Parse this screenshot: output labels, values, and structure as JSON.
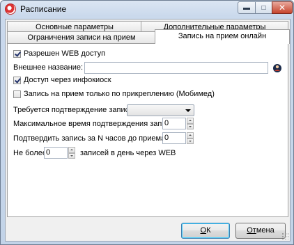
{
  "window": {
    "title": "Расписание",
    "minimize_icon": "minimize-icon",
    "maximize_icon": "maximize-icon",
    "close_icon": "close-icon"
  },
  "tabs": [
    {
      "label": "Основные параметры",
      "active": false
    },
    {
      "label": "Дополнительные параметры",
      "active": false
    },
    {
      "label": "Ограничения записи на прием",
      "active": false
    },
    {
      "label": "Запись на прием онлайн",
      "active": true
    }
  ],
  "form": {
    "web_access": {
      "label": "Разрешен WEB доступ",
      "checked": true
    },
    "external_name": {
      "label": "Внешнее название:",
      "value": "",
      "icon": "address-book-icon"
    },
    "infokiosk": {
      "label": "Доступ через инфокиоск",
      "checked": true
    },
    "attachment_only": {
      "label": "Запись на прием только по прикреплению (Мобимед)",
      "checked": false
    },
    "confirmation_required": {
      "label": "Требуется подтверждение записи:",
      "value": ""
    },
    "max_confirm_time": {
      "label": "Максимальное время подтверждения записи, ч:",
      "value": "0"
    },
    "confirm_hours_before": {
      "label": "Подтвердить запись за N часов до приема, ч:",
      "value": "0"
    },
    "max_per_day": {
      "prefix": "Не более",
      "value": "0",
      "suffix": "записей в день через WEB"
    }
  },
  "buttons": {
    "ok_mnemonic": "О",
    "ok_rest": "К",
    "cancel_mnemonic": "От",
    "cancel_rest": "мена"
  }
}
